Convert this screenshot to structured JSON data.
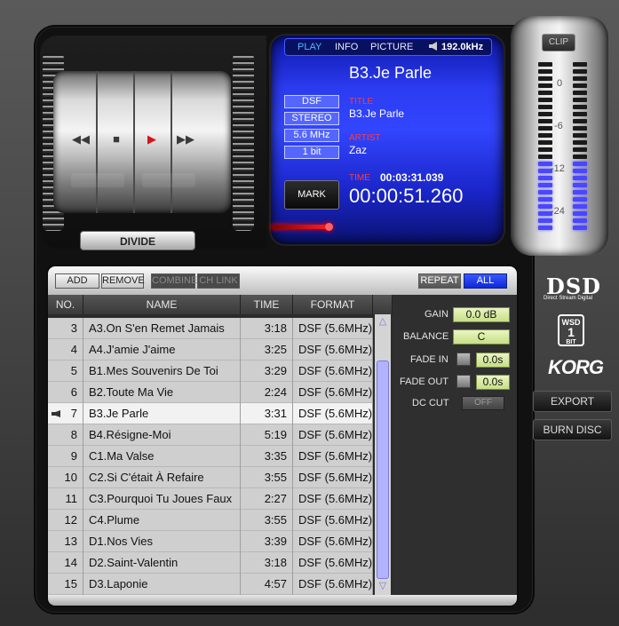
{
  "transport": {
    "rewind_icon": "rewind-icon",
    "stop_icon": "stop-icon",
    "play_icon": "play-icon",
    "forward_icon": "fast-forward-icon",
    "divide_label": "DIVIDE"
  },
  "display": {
    "tabs": [
      "PLAY",
      "INFO",
      "PICTURE"
    ],
    "active_tab": "PLAY",
    "sample_rate": "192.0kHz",
    "track_heading": "B3.Je Parle",
    "format": "DSF",
    "channels": "STEREO",
    "frequency": "5.6 MHz",
    "bits": "1 bit",
    "title_label": "TITLE",
    "title_value": "B3.Je Parle",
    "artist_label": "ARTIST",
    "artist_value": "Zaz",
    "time_label": "TIME",
    "total_time": "00:03:31.039",
    "current_time": "00:00:51.260",
    "mark_label": "MARK"
  },
  "meter": {
    "clip_label": "CLIP",
    "scale": [
      "0",
      "-6",
      "-12",
      "-24"
    ]
  },
  "toolbar": {
    "add": "ADD",
    "remove": "REMOVE",
    "combine": "COMBINE",
    "ch_link": "CH LINK",
    "repeat": "REPEAT",
    "all": "ALL"
  },
  "columns": {
    "no": "NO.",
    "name": "NAME",
    "time": "TIME",
    "format": "FORMAT"
  },
  "tracks": [
    {
      "no": "3",
      "name": "A3.On S'en Remet Jamais",
      "time": "3:18",
      "format": "DSF (5.6MHz)"
    },
    {
      "no": "4",
      "name": "A4.J'amie J'aime",
      "time": "3:25",
      "format": "DSF (5.6MHz)"
    },
    {
      "no": "5",
      "name": "B1.Mes Souvenirs De Toi",
      "time": "3:29",
      "format": "DSF (5.6MHz)"
    },
    {
      "no": "6",
      "name": "B2.Toute Ma Vie",
      "time": "2:24",
      "format": "DSF (5.6MHz)"
    },
    {
      "no": "7",
      "name": "B3.Je Parle",
      "time": "3:31",
      "format": "DSF (5.6MHz)",
      "selected": true
    },
    {
      "no": "8",
      "name": "B4.Résigne-Moi",
      "time": "5:19",
      "format": "DSF (5.6MHz)"
    },
    {
      "no": "9",
      "name": "C1.Ma Valse",
      "time": "3:35",
      "format": "DSF (5.6MHz)"
    },
    {
      "no": "10",
      "name": "C2.Si C'était À Refaire",
      "time": "3:55",
      "format": "DSF (5.6MHz)"
    },
    {
      "no": "11",
      "name": "C3.Pourquoi Tu Joues Faux",
      "time": "2:27",
      "format": "DSF (5.6MHz)"
    },
    {
      "no": "12",
      "name": "C4.Plume",
      "time": "3:55",
      "format": "DSF (5.6MHz)"
    },
    {
      "no": "13",
      "name": "D1.Nos Vies",
      "time": "3:39",
      "format": "DSF (5.6MHz)"
    },
    {
      "no": "14",
      "name": "D2.Saint-Valentin",
      "time": "3:18",
      "format": "DSF (5.6MHz)"
    },
    {
      "no": "15",
      "name": "D3.Laponie",
      "time": "4:57",
      "format": "DSF (5.6MHz)"
    }
  ],
  "properties": {
    "gain_label": "GAIN",
    "gain_value": "0.0 dB",
    "balance_label": "BALANCE",
    "balance_value": "C",
    "fade_in_label": "FADE IN",
    "fade_in_value": "0.0s",
    "fade_out_label": "FADE OUT",
    "fade_out_value": "0.0s",
    "dc_cut_label": "DC CUT",
    "dc_cut_value": "OFF"
  },
  "branding": {
    "dsd": "DSD",
    "dsd_sub": "Direct Stream Digital",
    "wsd_top": "WSD",
    "wsd_num": "1",
    "wsd_bottom": "BIT",
    "korg": "KORG"
  },
  "actions": {
    "export": "EXPORT",
    "burn_disc": "BURN DISC"
  },
  "colors": {
    "display_blue": "#3346ff",
    "accent_red": "#ff3b3b",
    "meter_lit": "#4a47ff",
    "value_green": "#c7df86"
  }
}
